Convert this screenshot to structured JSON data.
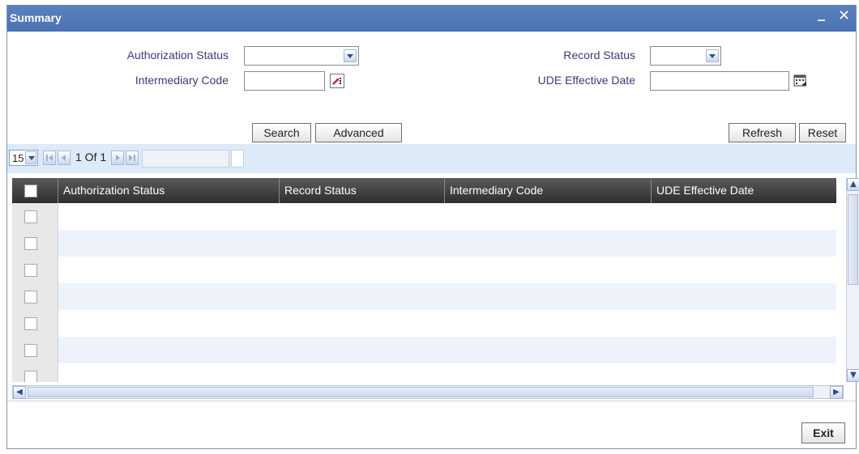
{
  "window": {
    "title": "Summary",
    "minimize_glyph": "_",
    "close_glyph": "✕"
  },
  "search_form": {
    "authorization_status_label": "Authorization Status",
    "authorization_status_value": "",
    "intermediary_code_label": "Intermediary Code",
    "intermediary_code_value": "",
    "record_status_label": "Record Status",
    "record_status_value": "",
    "ude_effective_date_label": "UDE Effective Date",
    "ude_effective_date_value": ""
  },
  "buttons": {
    "search": "Search",
    "advanced": "Advanced",
    "refresh": "Refresh",
    "reset": "Reset",
    "exit": "Exit"
  },
  "pagination": {
    "page_size": "15",
    "page_info": "1 Of 1",
    "goto_value": ""
  },
  "grid": {
    "columns": [
      "Authorization Status",
      "Record Status",
      "Intermediary Code",
      "UDE Effective Date"
    ],
    "row_count": 7
  },
  "colors": {
    "titlebar": "#4f76b5",
    "header_dark": "#3a3a3a",
    "row_alt": "#eef3fb",
    "toolbar": "#ddeaf7"
  },
  "icons": {
    "lov": "lov-icon",
    "calendar": "calendar-icon",
    "first": "first-page-icon",
    "prev": "prev-page-icon",
    "next": "next-page-icon",
    "last": "last-page-icon"
  }
}
